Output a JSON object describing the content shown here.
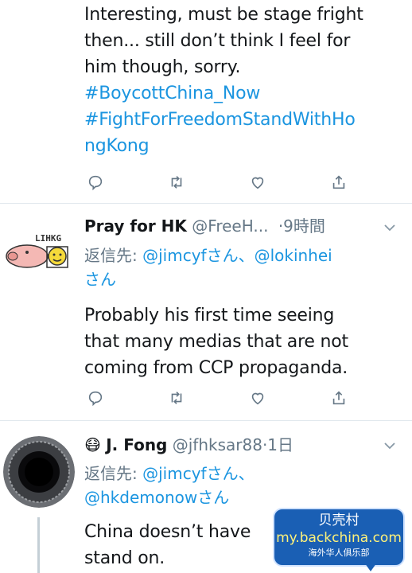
{
  "tweet1": {
    "lines": [
      "Interesting, must be stage fright",
      "then... still don’t think I feel for",
      "him though, sorry."
    ],
    "hashtags": [
      "#BoycottChina_Now",
      "#FightForFreedomStandWithHo",
      "ngKong"
    ]
  },
  "tweet2": {
    "name": "Pray for HK",
    "handle": "@FreeH...",
    "time": "·9時間",
    "avatar_text": "LIHKG",
    "reply_prefix": "返信先:",
    "reply_mentions": "@jimcyfさん、@lokinhei",
    "reply_tail": "さん",
    "lines": [
      "Probably his first time seeing",
      "that many medias that are not",
      "coming from CCP propaganda."
    ]
  },
  "tweet3": {
    "emoji": "😷",
    "name": "J. Fong",
    "handle": "@jfhksar88",
    "time": "·1日",
    "reply_prefix": "返信先:",
    "reply_mentions": "@jimcyfさん、",
    "reply_mentions2": "@hkdemonowさん",
    "lines": [
      "China doesn’t have",
      "stand on."
    ]
  },
  "watermark": {
    "title": "贝壳村",
    "url": "my.backchina.com",
    "subtitle": "海外华人俱乐部"
  },
  "colors": {
    "link": "#1b95e0",
    "secondary": "#657786",
    "divider": "#e1e8ed"
  }
}
